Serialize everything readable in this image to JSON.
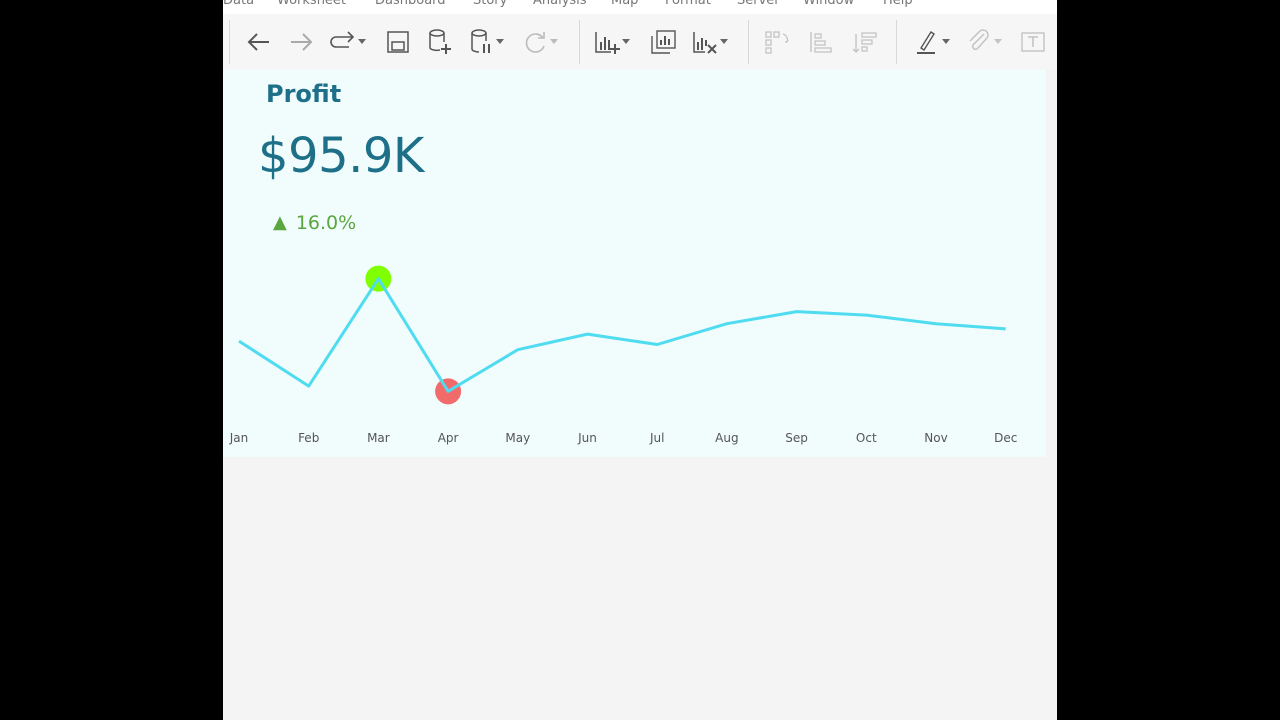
{
  "menu": {
    "items": [
      "Data",
      "Worksheet",
      "Dashboard",
      "Story",
      "Analysis",
      "Map",
      "Format",
      "Server",
      "Window",
      "Help"
    ]
  },
  "toolbar": {
    "icons": [
      "back-arrow-icon",
      "forward-arrow-icon",
      "redo-icon",
      "save-icon",
      "new-data-source-icon",
      "pause-updates-icon",
      "refresh-icon",
      "new-worksheet-icon",
      "duplicate-sheet-icon",
      "clear-sheet-icon",
      "swap-rows-columns-icon",
      "sort-ascending-icon",
      "sort-descending-icon",
      "highlight-icon",
      "annotate-icon",
      "label-icon"
    ]
  },
  "kpi": {
    "title": "Profit",
    "value": "$95.9K",
    "delta_arrow": "▲",
    "delta": "16.0%"
  },
  "chart_data": {
    "type": "line",
    "categories": [
      "Jan",
      "Feb",
      "Mar",
      "Apr",
      "May",
      "Jun",
      "Jul",
      "Aug",
      "Sep",
      "Oct",
      "Nov",
      "Dec"
    ],
    "values": [
      6.9,
      4.3,
      10.5,
      4.0,
      6.4,
      7.3,
      6.7,
      7.9,
      8.6,
      8.4,
      7.9,
      7.6
    ],
    "max_marker": {
      "category": "Mar",
      "color": "#7fff00"
    },
    "min_marker": {
      "category": "Apr",
      "color": "#f26b6b"
    },
    "line_color": "#4fdcf0",
    "grid": false,
    "title": "",
    "xlabel": "",
    "ylabel": ""
  },
  "colors": {
    "accent": "#1d7088",
    "positive": "#5aa640",
    "background": "#f1fcfd"
  }
}
